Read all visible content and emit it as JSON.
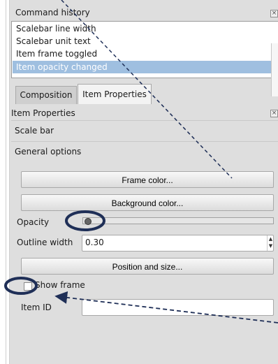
{
  "command_history": {
    "title": "Command history",
    "items": [
      "Scalebar line width",
      "Scalebar unit text",
      "Item frame toggled",
      "Item opacity changed"
    ],
    "close_glyph": "×"
  },
  "tabs": [
    "Composition",
    "Item Properties"
  ],
  "item_properties": {
    "title": "Item Properties",
    "item_type": "Scale bar",
    "section": "General options",
    "close_glyph": "×"
  },
  "general_options": {
    "frame_color_label": "Frame color...",
    "background_color_label": "Background color...",
    "opacity_label": "Opacity",
    "outline_width_label": "Outline width",
    "outline_width_value": "0.30",
    "position_size_label": "Position and size...",
    "show_frame_label": "Show frame",
    "item_id_label": "Item ID",
    "item_id_value": ""
  },
  "annotation_color": "#1f2f57"
}
